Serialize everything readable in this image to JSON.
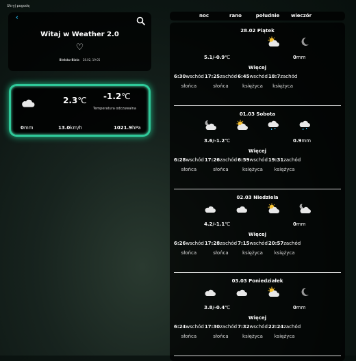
{
  "hide_label": "Ukryj pogodę",
  "welcome": {
    "title": "Witaj w Weather 2.0",
    "heart": "♡",
    "city": "Bielsko-Biała",
    "datetime": "28.02, 19:05"
  },
  "current": {
    "icon": "cloud",
    "temp": "2.3",
    "feels": "-1.2",
    "unit": "℃",
    "feels_label": "Temperatura odczuwalna",
    "precip": "0",
    "precip_unit": "mm",
    "wind": "13.0",
    "wind_unit": "km/h",
    "pressure": "1021.9",
    "pressure_unit": "hPa"
  },
  "header": [
    "noc",
    "rano",
    "południe",
    "wieczór"
  ],
  "more_label": "Więcej",
  "labels": {
    "sunrise": "wschód",
    "sunset": "zachód",
    "sun": "słońca",
    "moon": "księżyca",
    "unit": "℃",
    "mm": "mm"
  },
  "days": [
    {
      "title": "28.02 Piątek",
      "icons": [
        "",
        "",
        "partly-sunny",
        "moon"
      ],
      "temp": "5.1/-0.9",
      "precip": "0",
      "sunrise": "6:30",
      "sunset": "17:25",
      "moonrise": "6:45",
      "moonset": "18:7"
    },
    {
      "title": "01.03 Sobota",
      "icons": [
        "night-cloudy",
        "partly-sunny",
        "rain",
        "rain"
      ],
      "temp": "3.6/-1.2",
      "precip": "0.9",
      "sunrise": "6:28",
      "sunset": "17:26",
      "moonrise": "6:59",
      "moonset": "19:31"
    },
    {
      "title": "02.03 Niedziela",
      "icons": [
        "cloud",
        "cloud",
        "partly-sunny",
        "night-cloudy"
      ],
      "temp": "4.2/-1.1",
      "precip": "0",
      "sunrise": "6:26",
      "sunset": "17:28",
      "moonrise": "7:15",
      "moonset": "20:57"
    },
    {
      "title": "03.03 Poniedziałek",
      "icons": [
        "cloud",
        "cloud",
        "partly-sunny",
        "moon"
      ],
      "temp": "3.8/-0.4",
      "precip": "0",
      "sunrise": "6:24",
      "sunset": "17:30",
      "moonrise": "7:32",
      "moonset": "22:24"
    }
  ]
}
